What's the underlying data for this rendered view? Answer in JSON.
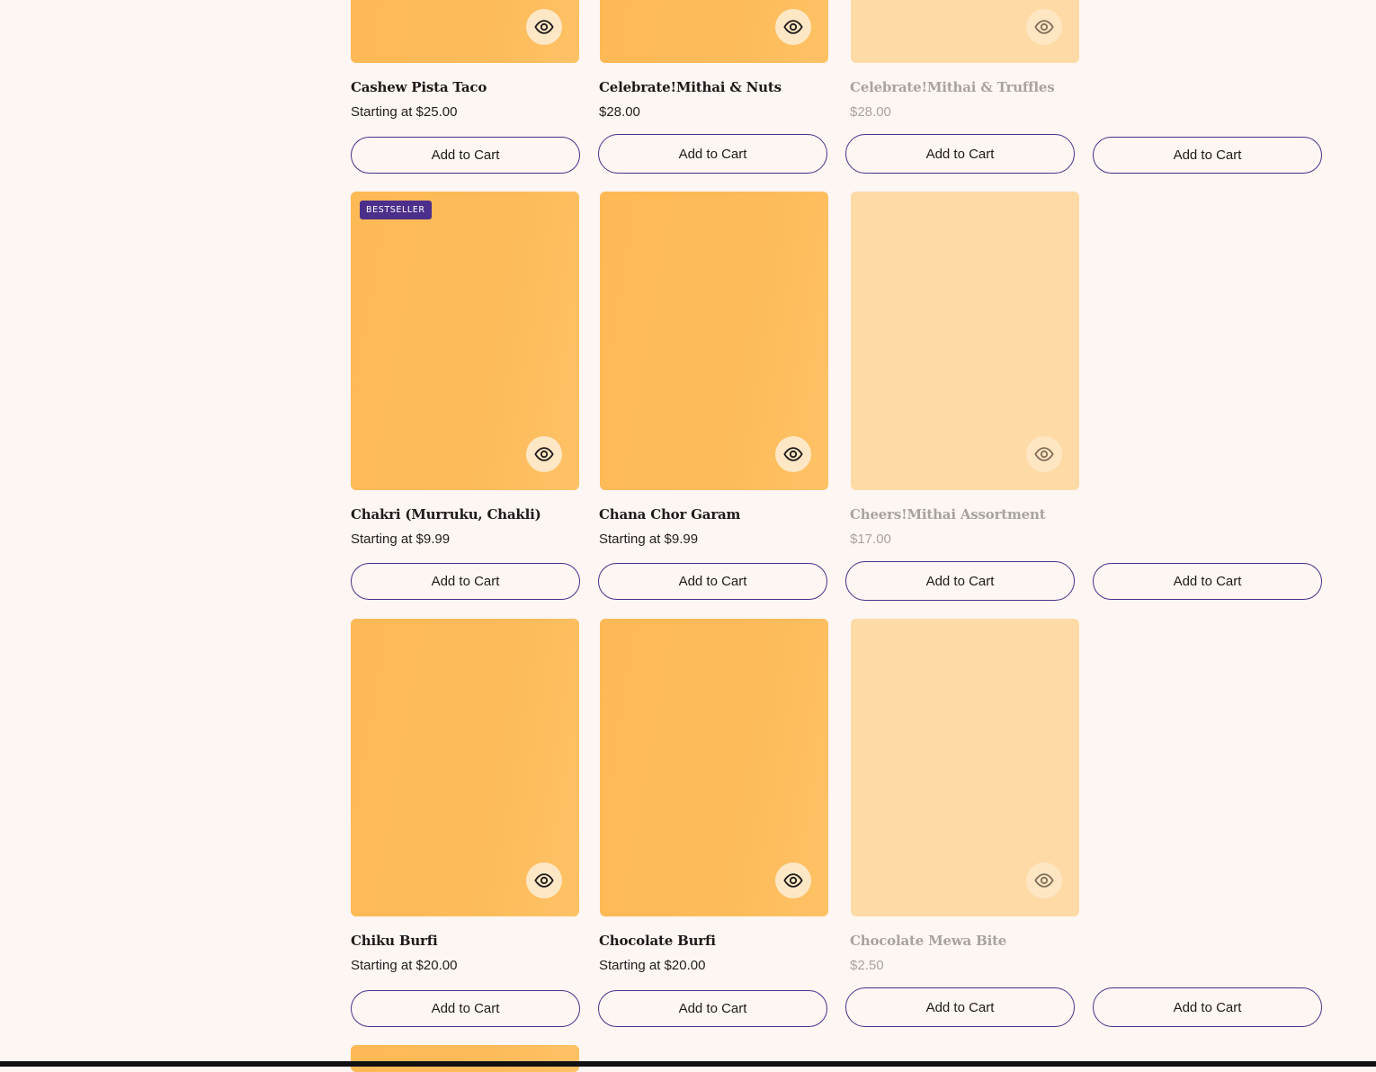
{
  "colors": {
    "background": "#fdf6f2",
    "card": "#fdb955",
    "card_faded": "#fedaa7",
    "accent": "#4c2f8a"
  },
  "icons": {
    "quick_view": "eye-icon"
  },
  "products": {
    "r0c0": {
      "title": "Cashew Pista Taco",
      "price": "Starting at $25.00"
    },
    "r0c1": {
      "title": "Celebrate!Mithai & Nuts",
      "price": "$28.00"
    },
    "r0c2": {
      "title": "Celebrate!Mithai & Truffles",
      "price": "$28.00"
    },
    "r1c0": {
      "title": "Chakri (Murruku, Chakli)",
      "price": "Starting at $9.99",
      "badge": "BESTSELLER"
    },
    "r1c1": {
      "title": "Chana Chor Garam",
      "price": "Starting at $9.99"
    },
    "r1c2": {
      "title": "Cheers!Mithai Assortment",
      "price": "$17.00"
    },
    "r2c0": {
      "title": "Chiku Burfi",
      "price": "Starting at $20.00"
    },
    "r2c1": {
      "title": "Chocolate Burfi",
      "price": "Starting at $20.00"
    },
    "r2c2": {
      "title": "Chocolate Mewa Bite",
      "price": "$2.50"
    }
  },
  "cart": {
    "add_label": "Add to Cart"
  }
}
